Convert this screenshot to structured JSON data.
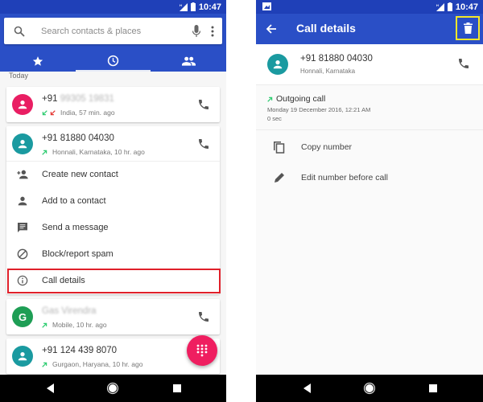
{
  "colors": {
    "primary": "#2a4fc6",
    "status_bar": "#1f40b8",
    "fab": "#ef1e60",
    "avatar_pink": "#e91e63",
    "avatar_teal": "#1a9aa0",
    "avatar_green": "#1e9e55",
    "missed_red": "#e53935",
    "outgoing_green": "#2ecc71",
    "highlight_red": "#e0202a",
    "highlight_yellow": "#f4e72a"
  },
  "left_screen": {
    "status_bar": {
      "time": "10:47",
      "network": "H"
    },
    "search": {
      "placeholder": "Search contacts & places"
    },
    "tabs": [
      {
        "name": "speed-dial",
        "icon": "star-icon",
        "active": false
      },
      {
        "name": "recents",
        "icon": "clock-icon",
        "active": true
      },
      {
        "name": "contacts",
        "icon": "people-icon",
        "active": false
      }
    ],
    "section_label": "Today",
    "entries": [
      {
        "prefix": "+91 ",
        "name": "99305 19831",
        "name_blurred": true,
        "subtitle": "India, 57 min. ago",
        "call_icons": [
          "missed",
          "missed"
        ],
        "avatar_letter": "",
        "avatar_color": "pink"
      },
      {
        "prefix": "",
        "name": "+91 81880 04030",
        "name_blurred": false,
        "subtitle": "Honnali, Karnataka, 10 hr. ago",
        "call_icons": [
          "outgoing"
        ],
        "avatar_letter": "",
        "avatar_color": "teal",
        "expanded": true
      },
      {
        "prefix": "",
        "name": "Gas Virendra",
        "name_blurred": true,
        "subtitle": "Mobile, 10 hr. ago",
        "call_icons": [
          "outgoing"
        ],
        "avatar_letter": "G",
        "avatar_color": "green"
      },
      {
        "prefix": "",
        "name": "+91 124 439 8070",
        "name_blurred": false,
        "subtitle": "Gurgaon, Haryana, 10 hr. ago",
        "call_icons": [
          "outgoing"
        ],
        "avatar_letter": "",
        "avatar_color": "teal"
      }
    ],
    "expanded_menu": [
      {
        "label": "Create new contact",
        "icon": "person-add-icon"
      },
      {
        "label": "Add to a contact",
        "icon": "person-icon"
      },
      {
        "label": "Send a message",
        "icon": "message-icon"
      },
      {
        "label": "Block/report spam",
        "icon": "block-icon"
      },
      {
        "label": "Call details",
        "icon": "info-icon",
        "highlighted": true
      }
    ],
    "fab_icon": "dialpad-icon"
  },
  "right_screen": {
    "status_bar": {
      "time": "10:47",
      "network": "H"
    },
    "app_bar": {
      "title": "Call details",
      "back_icon": "arrow-back-icon",
      "action_icon": "delete-icon",
      "action_highlighted": true
    },
    "contact": {
      "number": "+91 81880 04030",
      "location": "Honnali, Karnataka"
    },
    "call": {
      "type": "Outgoing call",
      "date": "Monday 19 December 2016, 12:21 AM",
      "duration": "0 sec"
    },
    "actions": [
      {
        "label": "Copy number",
        "icon": "copy-icon"
      },
      {
        "label": "Edit number before call",
        "icon": "edit-icon"
      }
    ]
  },
  "nav_bar": {
    "buttons": [
      "back",
      "home",
      "recents"
    ]
  }
}
